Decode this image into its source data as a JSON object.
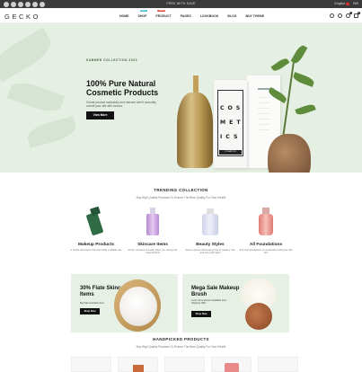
{
  "topbar": {
    "promo": "FREE WITH SAVE",
    "language": "English",
    "currency": "INR",
    "socials": [
      "facebook-icon",
      "twitter-icon",
      "instagram-icon",
      "pinterest-icon",
      "linkedin-icon",
      "youtube-icon"
    ]
  },
  "header": {
    "logo": "GECKO",
    "nav": [
      {
        "label": "HOME",
        "badge": ""
      },
      {
        "label": "SHOP",
        "badge": "NEW",
        "badge_color": "#3fb8d8"
      },
      {
        "label": "PRODUCT",
        "badge": "SALE",
        "badge_color": "#e2463b"
      },
      {
        "label": "PAGES",
        "badge": ""
      },
      {
        "label": "LOOKBOOK",
        "badge": ""
      },
      {
        "label": "BLOG",
        "badge": ""
      },
      {
        "label": "BUY THEME",
        "badge": ""
      }
    ],
    "icons": [
      "search-icon",
      "user-icon",
      "heart-icon",
      "bag-icon"
    ],
    "wishlist_count": "0",
    "cart_count": "0"
  },
  "hero": {
    "eyebrow": "SUMMER COLLECTION 2023",
    "title": "100% Pure Natural Cosmetic Products",
    "description": "Create product modularity and relevant with it smoothly overall your site with colours.",
    "button": "View More",
    "box_word_lines": [
      "COS",
      "MET",
      "ICS"
    ],
    "box_label": "COSMETICS",
    "accent": "#e6efe4"
  },
  "trending": {
    "title": "TRENDING COLLECTION",
    "subtitle": "Buy High Quality Products To Ensure The Best Quality For Your Health",
    "categories": [
      {
        "name": "Makeup Products",
        "desc": "A simple description that will modify a reliable day"
      },
      {
        "name": "Skincare Items",
        "desc": "All the moments of quality when you change the essential kind"
      },
      {
        "name": "Beauty Styles",
        "desc": "Show a person that looking how to create a new and bring right glow"
      },
      {
        "name": "All Foundations",
        "desc": "Soft matt foundations to complement and grow with skin"
      }
    ]
  },
  "banners": [
    {
      "title": "30% Flate Skincare Items",
      "desc": "Big Sale Available Now",
      "button": "Shop Now"
    },
    {
      "title": "Mega Sale Makeup Brush",
      "desc": "Lorem Free Return Available Free Shipping Offer",
      "button": "Shop Now"
    }
  ],
  "handpicked": {
    "title": "HANDPICKED PRODUCTS",
    "subtitle": "Buy High Quality Products To Ensure The Best Quality For Your Health"
  }
}
